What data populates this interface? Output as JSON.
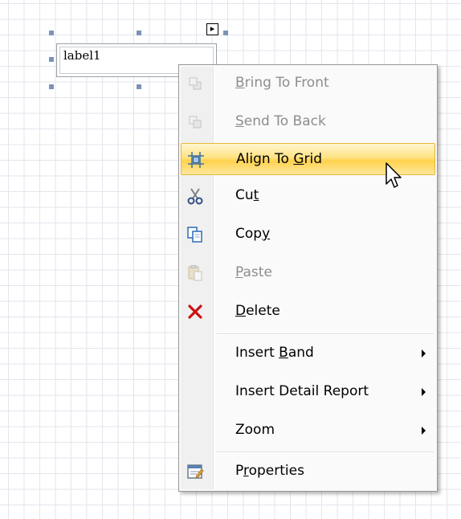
{
  "designer": {
    "label_text": "label1",
    "smart_tag_glyph": "▸"
  },
  "context_menu": {
    "items": [
      {
        "label": "Bring To Front",
        "mnemonic_index": 0,
        "icon": "bring-to-front-icon",
        "enabled": false
      },
      {
        "label": "Send To Back",
        "mnemonic_index": 0,
        "icon": "send-to-back-icon",
        "enabled": false
      },
      {
        "label": "Align To Grid",
        "mnemonic_index": 9,
        "icon": "align-to-grid-icon",
        "enabled": true,
        "highlighted": true
      },
      {
        "label": "Cut",
        "mnemonic_index": 2,
        "icon": "scissors-icon",
        "enabled": true
      },
      {
        "label": "Copy",
        "mnemonic_index": 3,
        "icon": "copy-icon",
        "enabled": true
      },
      {
        "label": "Paste",
        "mnemonic_index": 0,
        "icon": "paste-icon",
        "enabled": false
      },
      {
        "label": "Delete",
        "mnemonic_index": 0,
        "icon": "delete-icon",
        "enabled": true
      },
      {
        "label": "Insert Band",
        "mnemonic_index": 7,
        "icon": "",
        "enabled": true,
        "submenu": true
      },
      {
        "label": "Insert Detail Report",
        "mnemonic_index": -1,
        "icon": "",
        "enabled": true,
        "submenu": true
      },
      {
        "label": "Zoom",
        "mnemonic_index": -1,
        "icon": "",
        "enabled": true,
        "submenu": true
      },
      {
        "label": "Properties",
        "mnemonic_index": 1,
        "icon": "properties-icon",
        "enabled": true
      }
    ]
  },
  "colors": {
    "highlight": "#ffd24d",
    "delete_red": "#cc1111",
    "disabled_text": "#8d8d8d"
  }
}
